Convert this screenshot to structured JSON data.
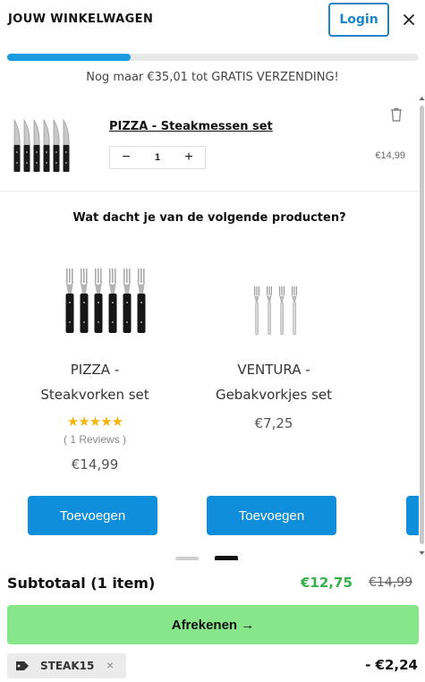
{
  "header": {
    "title": "JOUW WINKELWAGEN",
    "login_label": "Login"
  },
  "shipping": {
    "progress_fraction": 0.3,
    "message": "Nog maar €35,01 tot GRATIS VERZENDING!"
  },
  "cart_item": {
    "name": "PIZZA - Steakmessen set",
    "quantity": "1",
    "minus_label": "−",
    "plus_label": "+",
    "price": "€14,99",
    "icon": "trash-icon"
  },
  "upsell": {
    "title": "Wat dacht je van de volgende producten?",
    "products": [
      {
        "name_line1": "PIZZA -",
        "name_line2": "Steakvorken set",
        "stars": "★★★★★",
        "rating": 5,
        "reviews": "( 1 Reviews )",
        "price": "€14,99",
        "button_label": "Toevoegen"
      },
      {
        "name_line1": "VENTURA -",
        "name_line2": "Gebakvorkjes set",
        "price": "€7,25",
        "button_label": "Toevoegen"
      }
    ]
  },
  "footer": {
    "subtotal_label": "Subtotaal (1 item)",
    "subtotal_new": "€12,75",
    "subtotal_old": "€14,99",
    "checkout_label": "Afrekenen →",
    "coupon_code": "STEAK15",
    "coupon_remove": "×",
    "discount": "- €2,24"
  },
  "colors": {
    "accent_blue": "#0f8fdb",
    "checkout_green": "#87e58a",
    "price_green": "#34b04b",
    "star_yellow": "#f5b50a"
  }
}
